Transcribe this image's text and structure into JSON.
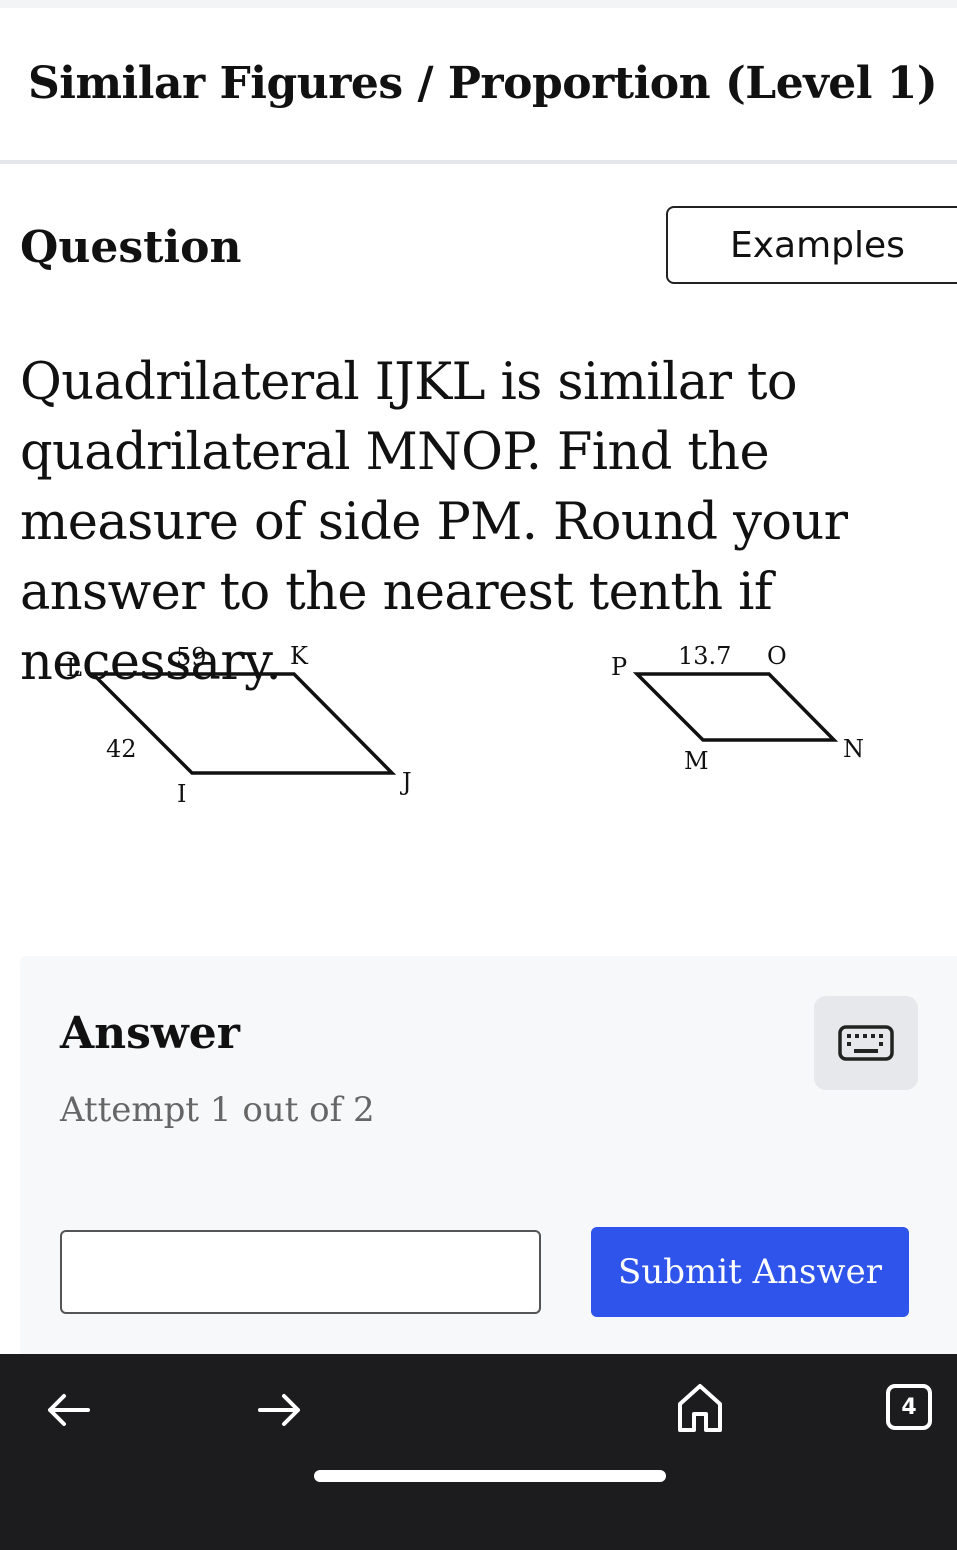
{
  "header": {
    "title": "Similar Figures / Proportion (Level 1)"
  },
  "question": {
    "heading": "Question",
    "examples_label": "Examples",
    "text": "Quadrilateral IJKL is similar to quadrilateral MNOP. Find the measure of side PM. Round your answer to the nearest tenth if necessary."
  },
  "figure": {
    "ijkl": {
      "L": "L",
      "K": "K",
      "J": "J",
      "I": "I",
      "side_lk": "59",
      "side_li": "42"
    },
    "mnop": {
      "P": "P",
      "O": "O",
      "N": "N",
      "M": "M",
      "side_po": "13.7"
    }
  },
  "answer": {
    "heading": "Answer",
    "attempt": "Attempt 1 out of 2",
    "input_value": "",
    "submit_label": "Submit Answer"
  },
  "browser_nav": {
    "tab_count": "4"
  }
}
